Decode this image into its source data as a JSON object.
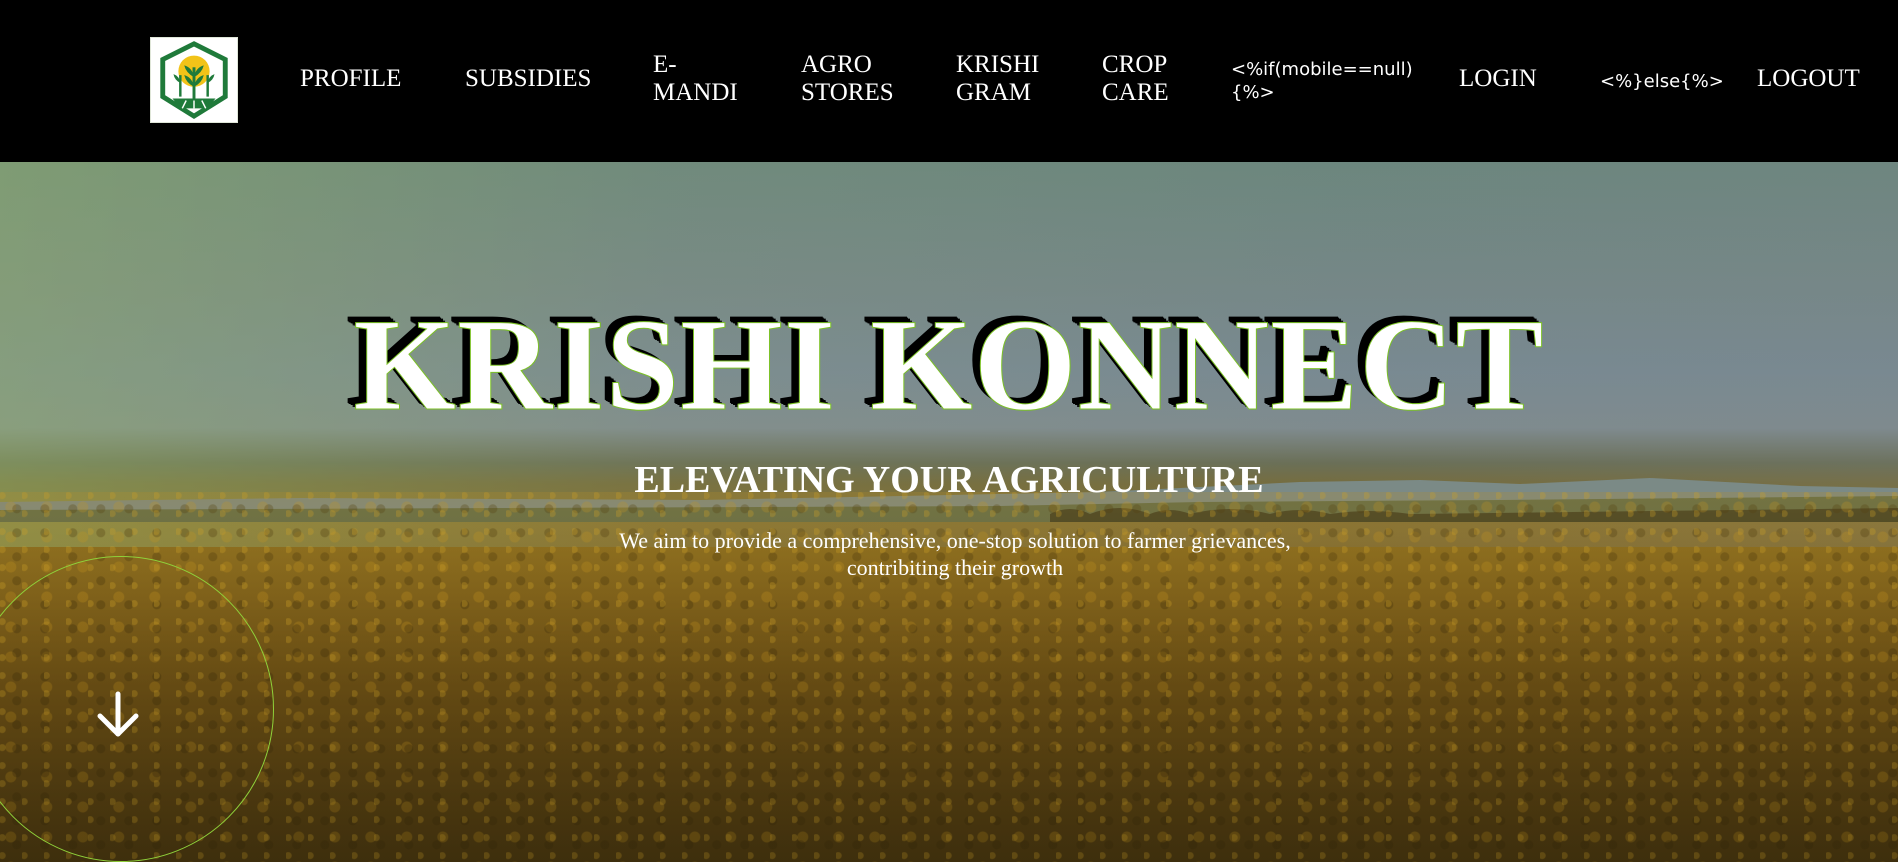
{
  "logo": {
    "icon": "krishi-konnect-logo-icon",
    "colors": {
      "green": "#1f7a3a",
      "yellow": "#f2c318"
    }
  },
  "nav": {
    "profile": "PROFILE",
    "subsidies": "SUBSIDIES",
    "emandi": "E-MANDI",
    "agro_stores": "AGRO STORES",
    "krishi_gram": "KRISHI GRAM",
    "crop_care": "CROP CARE",
    "template_if": "<%if(mobile==null){%>",
    "login": "LOGIN",
    "template_else": "<%}else{%>",
    "logout": "LOGOUT"
  },
  "hero": {
    "title": "KRISHI KONNECT",
    "subtitle": "ELEVATING YOUR AGRICULTURE",
    "description": "We aim to provide a comprehensive, one-stop solution to farmer grievances, contribiting their growth",
    "scroll_icon": "arrow-down-icon"
  },
  "colors": {
    "accent": "#8fd13a",
    "nav_bg": "#000000",
    "text": "#ffffff"
  }
}
